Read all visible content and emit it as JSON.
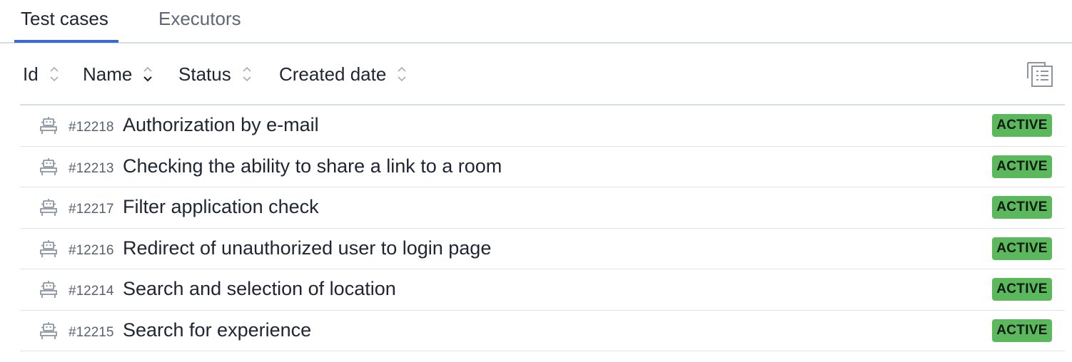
{
  "tabs": [
    {
      "label": "Test cases",
      "active": true
    },
    {
      "label": "Executors",
      "active": false
    }
  ],
  "columns": [
    {
      "label": "Id",
      "sort": "none"
    },
    {
      "label": "Name",
      "sort": "desc"
    },
    {
      "label": "Status",
      "sort": "none"
    },
    {
      "label": "Created date",
      "sort": "none"
    }
  ],
  "toolbar": {
    "settings_icon": "column-settings-icon"
  },
  "rows": [
    {
      "id": "#12218",
      "name": "Authorization by e-mail",
      "status": "ACTIVE",
      "icon": "robot-icon"
    },
    {
      "id": "#12213",
      "name": "Checking the ability to share a link to a room",
      "status": "ACTIVE",
      "icon": "robot-icon"
    },
    {
      "id": "#12217",
      "name": "Filter application check",
      "status": "ACTIVE",
      "icon": "robot-icon"
    },
    {
      "id": "#12216",
      "name": "Redirect of unauthorized user to login page",
      "status": "ACTIVE",
      "icon": "robot-icon"
    },
    {
      "id": "#12214",
      "name": "Search and selection of location",
      "status": "ACTIVE",
      "icon": "robot-icon"
    },
    {
      "id": "#12215",
      "name": "Search for experience",
      "status": "ACTIVE",
      "icon": "robot-icon"
    }
  ],
  "colors": {
    "accent": "#3b6ad6",
    "status_active": "#5cb85c",
    "divider": "#d6dde4"
  }
}
